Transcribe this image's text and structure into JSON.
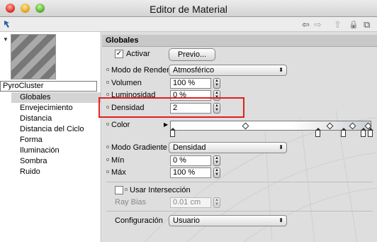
{
  "window": {
    "title": "Editor de Material"
  },
  "toolbar": {
    "pick_icon": "arrow-pointer-icon",
    "back_symbol": "⇦",
    "forward_symbol": "⇨",
    "up_symbol": "⇧",
    "lock_symbol": "🔒",
    "newwin_symbol": "⧉"
  },
  "tree": {
    "root": "PyroCluster",
    "items": [
      "Globales",
      "Envejecimiento",
      "Distancia",
      "Distancia del Ciclo",
      "Forma",
      "Iluminación",
      "Sombra",
      "Ruido"
    ],
    "selected": "Globales"
  },
  "section": {
    "title": "Globales"
  },
  "activar": {
    "label": "Activar",
    "checked": true,
    "preview_button": "Previo..."
  },
  "modo_render": {
    "label": "Modo de Render",
    "value": "Atmosférico"
  },
  "volumen": {
    "label": "Volumen",
    "value": "100 %"
  },
  "luminosidad": {
    "label": "Luminosidad",
    "value": "0 %"
  },
  "densidad": {
    "label": "Densidad",
    "value": "2"
  },
  "color": {
    "label": "Color"
  },
  "modo_gradiente": {
    "label": "Modo Gradiente",
    "value": "Densidad"
  },
  "min": {
    "label": "Mín",
    "value": "0 %"
  },
  "max": {
    "label": "Máx",
    "value": "100 %"
  },
  "interseccion": {
    "label": "Usar Intersección",
    "checked": false
  },
  "ray_bias": {
    "label": "Ray Bias",
    "value": "0.01 cm"
  },
  "configuracion": {
    "label": "Configuración",
    "value": "Usuario"
  },
  "highlight_color": "#e01f1f"
}
